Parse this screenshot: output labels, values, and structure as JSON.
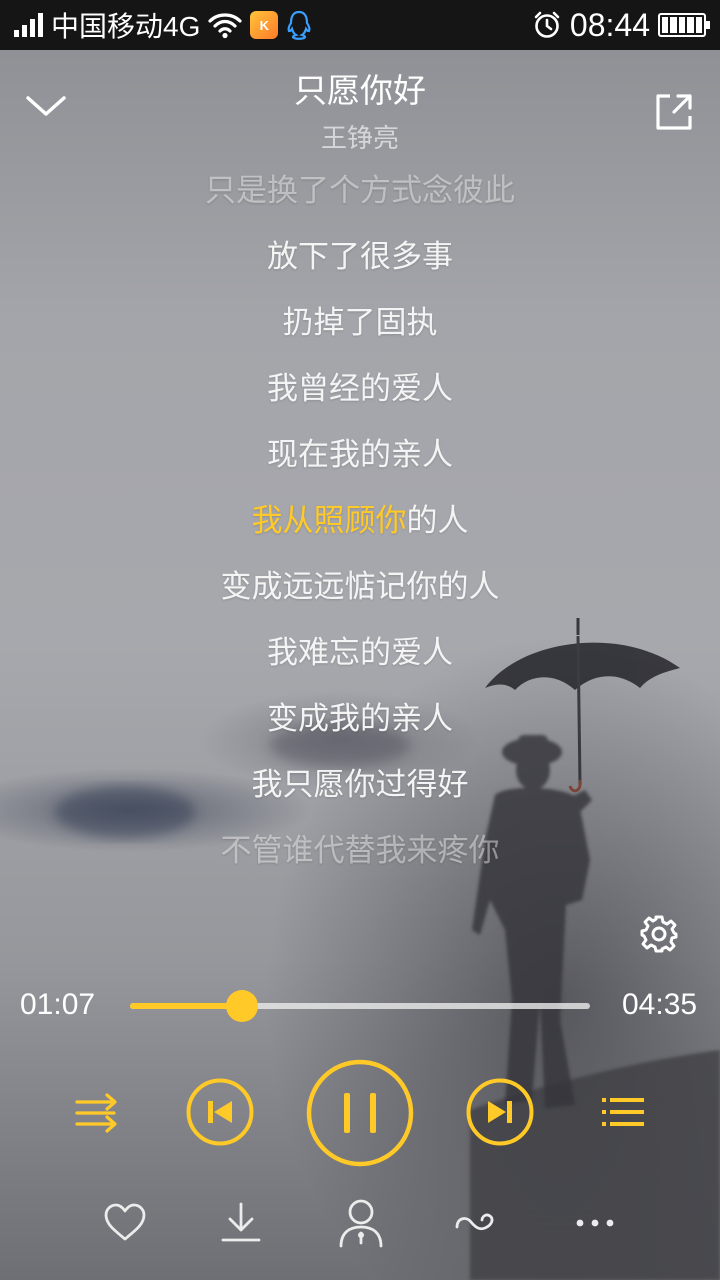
{
  "status_bar": {
    "carrier": "中国移动4G",
    "app_badge": "K",
    "time": "08:44"
  },
  "header": {
    "title": "只愿你好",
    "artist": "王铮亮"
  },
  "lyrics": {
    "lines": [
      "只是换了个方式念彼此",
      "放下了很多事",
      "扔掉了固执",
      "我曾经的爱人",
      "现在我的亲人",
      "我从照顾你的人",
      "变成远远惦记你的人",
      "我难忘的爱人",
      "变成我的亲人",
      "我只愿你过得好",
      "不管谁代替我来疼你"
    ],
    "current_sung": "我从照顾你",
    "current_rest": "的人"
  },
  "player": {
    "current_time": "01:07",
    "total_time": "04:35",
    "progress": 0.243
  },
  "colors": {
    "accent": "#ffc928",
    "status_bar": "#151515"
  },
  "icons": {
    "collapse": "chevron-down-icon",
    "share": "share-icon",
    "settings": "gear-icon",
    "shuffle": "shuffle-icon",
    "previous": "skip-previous-icon",
    "play_pause": "pause-icon",
    "next": "skip-next-icon",
    "playlist": "playlist-icon",
    "favorite": "heart-icon",
    "download": "download-icon",
    "singer": "singer-icon",
    "effect": "sound-effect-icon",
    "more": "more-icon"
  }
}
